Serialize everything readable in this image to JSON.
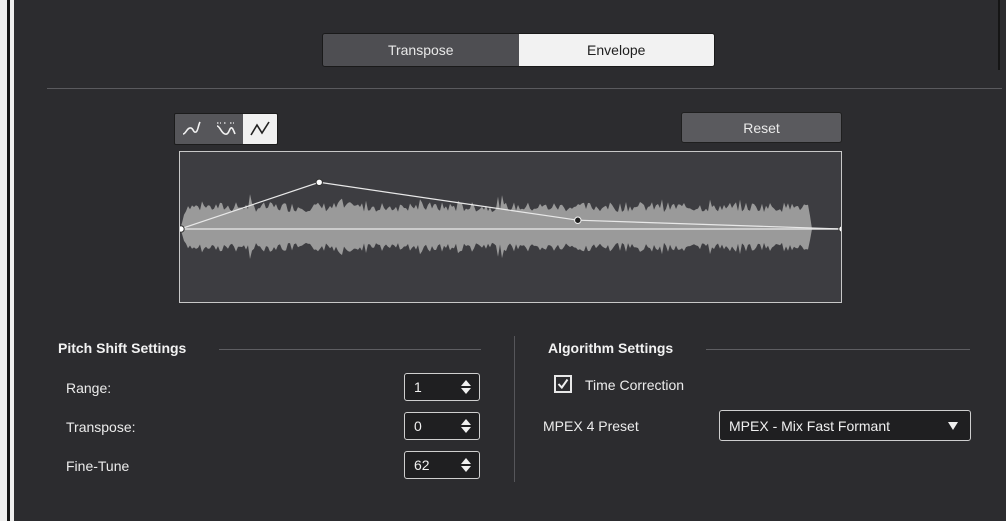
{
  "tabs": [
    {
      "label": "Transpose",
      "active": false
    },
    {
      "label": "Envelope",
      "active": true
    }
  ],
  "curve_modes": [
    {
      "icon": "smooth-curve-icon",
      "active": false
    },
    {
      "icon": "spline-curve-icon",
      "active": false
    },
    {
      "icon": "linear-curve-icon",
      "active": true
    }
  ],
  "envelope": {
    "reset_label": "Reset",
    "points": [
      {
        "t": 0.0,
        "level": 0.5
      },
      {
        "t": 0.21,
        "level": 0.82
      },
      {
        "t": 0.6,
        "level": 0.56
      },
      {
        "t": 1.0,
        "level": 0.5
      }
    ],
    "waveform_color": "#9a9a9a",
    "line_color": "#e8e8e8"
  },
  "pitch_shift": {
    "title": "Pitch Shift Settings",
    "rows": [
      {
        "label": "Range:",
        "value": "1"
      },
      {
        "label": "Transpose:",
        "value": "0"
      },
      {
        "label": "Fine-Tune",
        "value": "62"
      }
    ]
  },
  "algorithm": {
    "title": "Algorithm Settings",
    "time_correction_label": "Time Correction",
    "time_correction_checked": true,
    "preset_label": "MPEX 4 Preset",
    "preset_value": "MPEX - Mix Fast Formant"
  }
}
